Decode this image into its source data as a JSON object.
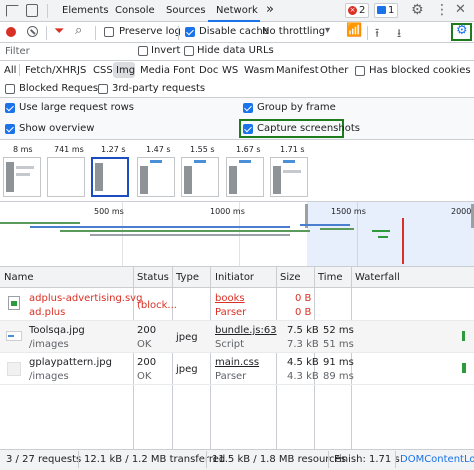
{
  "tabs": {
    "items": [
      "Elements",
      "Console",
      "Sources",
      "Network"
    ],
    "active": "Network",
    "more": "»",
    "errors_count": "2",
    "messages_count": "1"
  },
  "toolbar": {
    "preserve_log": "Preserve log",
    "disable_cache": "Disable cache",
    "throttling": "No throttling"
  },
  "filter": {
    "placeholder": "Filter",
    "invert": "Invert",
    "hide_data_urls": "Hide data URLs"
  },
  "types": {
    "items": [
      "All",
      "Fetch/XHR",
      "JS",
      "CSS",
      "Img",
      "Media",
      "Font",
      "Doc",
      "WS",
      "Wasm",
      "Manifest",
      "Other"
    ],
    "active": "Img",
    "has_blocked_cookies": "Has blocked cookies",
    "blocked_requests": "Blocked Requests",
    "third_party": "3rd-party requests"
  },
  "settings": {
    "large_rows": "Use large request rows",
    "group_by_frame": "Group by frame",
    "show_overview": "Show overview",
    "capture_screenshots": "Capture screenshots"
  },
  "filmstrip": [
    "8 ms",
    "741 ms",
    "1.27 s",
    "1.47 s",
    "1.55 s",
    "1.67 s",
    "1.71 s"
  ],
  "timeline": {
    "ticks": [
      "500 ms",
      "1000 ms",
      "1500 ms",
      "2000 ms"
    ]
  },
  "table": {
    "headers": [
      "Name",
      "Status",
      "Type",
      "Initiator",
      "Size",
      "Time",
      "Waterfall"
    ],
    "rows": [
      {
        "name": "adplus-advertising.svg",
        "path": "ad.plus",
        "status": "(block...",
        "status2": "",
        "type": "",
        "initiator": "books",
        "initiator2": "Parser",
        "size": "0 B",
        "size2": "0 B",
        "time": "",
        "time2": "",
        "error": true
      },
      {
        "name": "Toolsqa.jpg",
        "path": "/images",
        "status": "200",
        "status2": "OK",
        "type": "jpeg",
        "initiator": "bundle.js:63",
        "initiator2": "Script",
        "size": "7.5 kB",
        "size2": "7.3 kB",
        "time": "52 ms",
        "time2": "51 ms",
        "error": false
      },
      {
        "name": "gplaypattern.jpg",
        "path": "/images",
        "status": "200",
        "status2": "OK",
        "type": "jpeg",
        "initiator": "main.css",
        "initiator2": "Parser",
        "size": "4.5 kB",
        "size2": "4.3 kB",
        "time": "91 ms",
        "time2": "89 ms",
        "error": false
      }
    ]
  },
  "status_bar": {
    "requests": "3 / 27 requests",
    "transferred": "12.1 kB / 1.2 MB transferred",
    "resources": "11.5 kB / 1.8 MB resources",
    "finish": "Finish: 1.71 s",
    "dom": "DOMContentLoad"
  },
  "colors": {
    "active_tab": "#1a73e8",
    "error": "#d93025",
    "highlight": "#1e7c1e"
  }
}
